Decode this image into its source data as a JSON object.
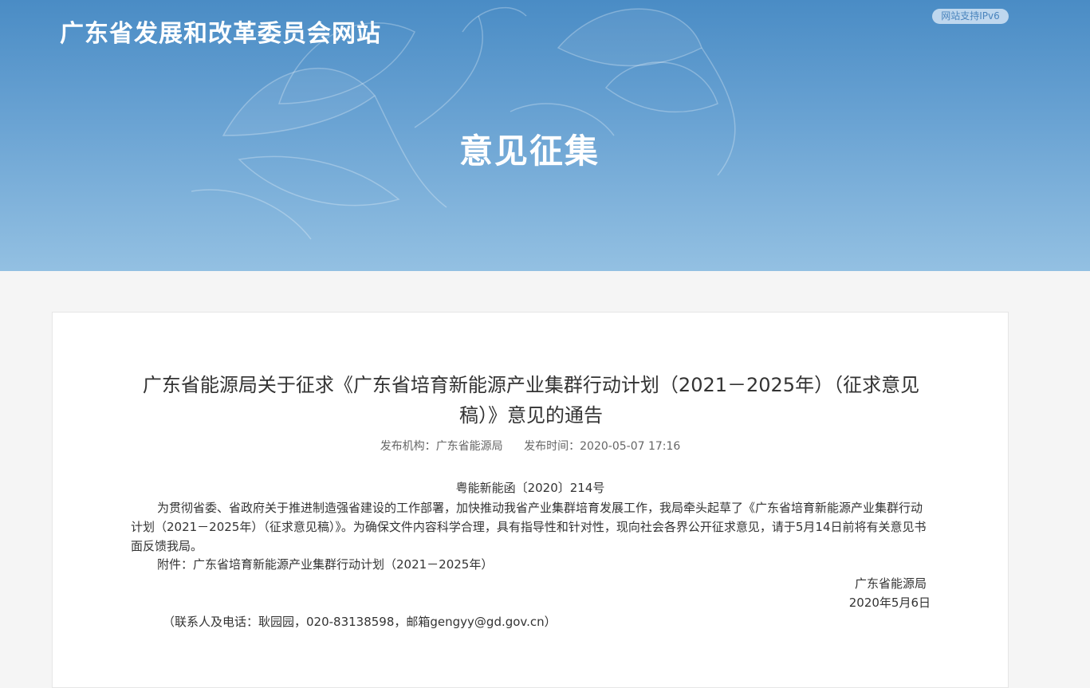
{
  "header": {
    "site_title": "广东省发展和改革委员会网站",
    "ipv6_badge": "网站支持IPv6",
    "section_title": "意见征集"
  },
  "article": {
    "title": "广东省能源局关于征求《广东省培育新能源产业集群行动计划（2021－2025年）（征求意见稿）》意见的通告",
    "publisher_label": "发布机构：",
    "publisher": "广东省能源局",
    "time_label": "发布时间：",
    "time": "2020-05-07 17:16",
    "doc_number": "粤能新能函〔2020〕214号",
    "paragraph": "为贯彻省委、省政府关于推进制造强省建设的工作部署，加快推动我省产业集群培育发展工作，我局牵头起草了《广东省培育新能源产业集群行动计划（2021－2025年）（征求意见稿）》。为确保文件内容科学合理，具有指导性和针对性，现向社会各界公开征求意见，请于5月14日前将有关意见书面反馈我局。",
    "attachment": "附件：广东省培育新能源产业集群行动计划（2021－2025年）",
    "sign_org": "广东省能源局",
    "sign_date": "2020年5月6日",
    "contact": "（联系人及电话：耿园园，020-83138598，邮箱gengyy@gd.gov.cn）"
  },
  "colors": {
    "banner_top": "#4a8cc5",
    "banner_bottom": "#93c0e2",
    "page_bg": "#f5f5f5",
    "card_bg": "#ffffff"
  }
}
